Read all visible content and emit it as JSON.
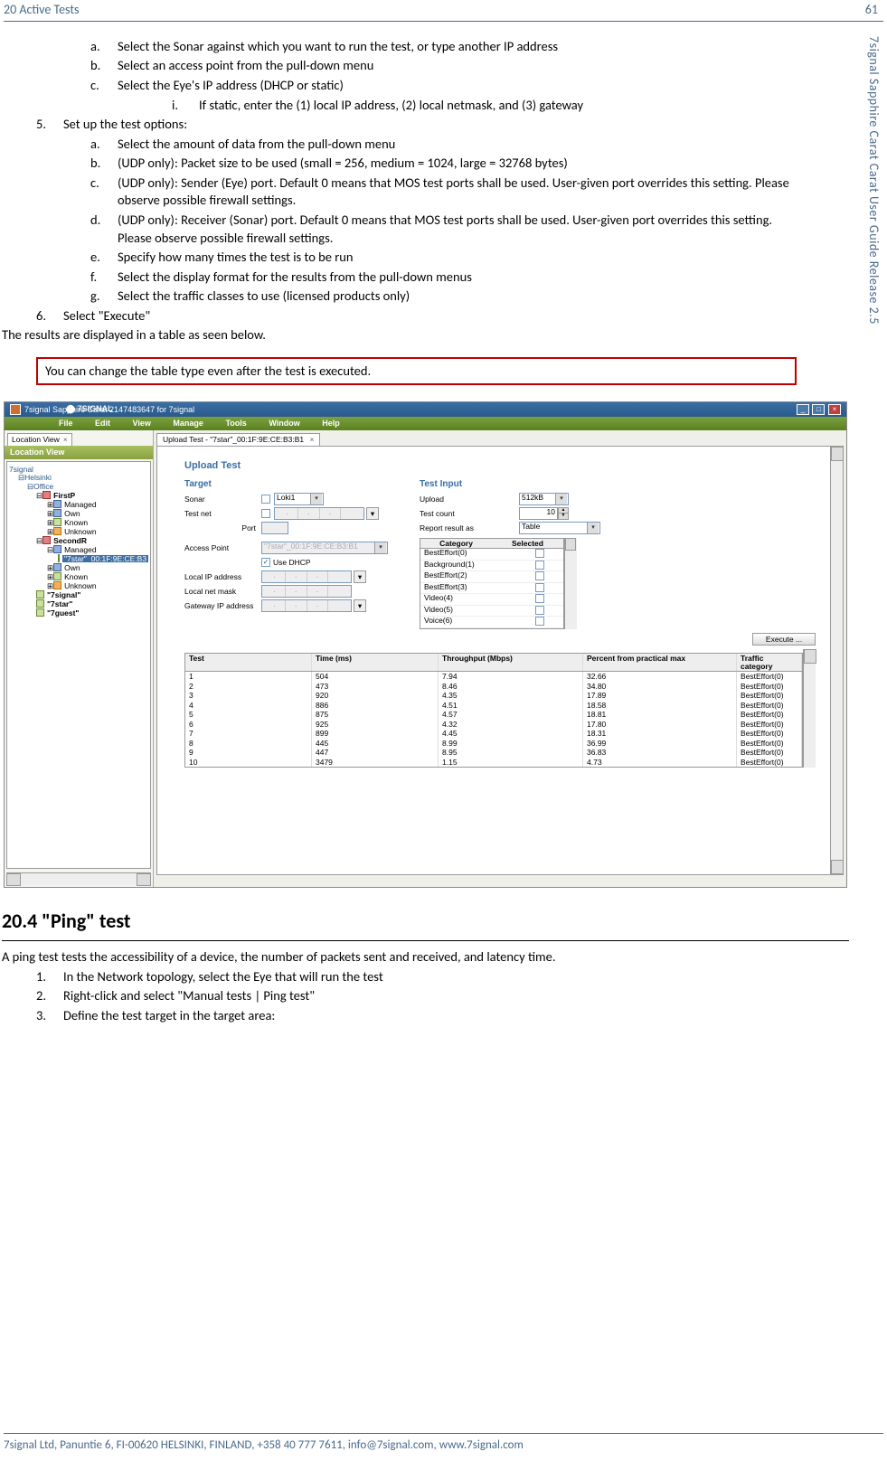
{
  "header": {
    "left": "20 Active Tests",
    "right": "61"
  },
  "vertical_label": "7signal Sapphire Carat Carat User Guide Release 2.5",
  "steps": {
    "a4": {
      "m": "a.",
      "t": "Select the Sonar against which you want to run the test, or type another IP address"
    },
    "b4": {
      "m": "b.",
      "t": "Select an access point from the pull-down menu"
    },
    "c4": {
      "m": "c.",
      "t": "Select the Eye's IP address (DHCP or static)"
    },
    "c4i": {
      "m": "i.",
      "t": "If static, enter the (1) local IP address, (2) local netmask, and (3) gateway"
    },
    "s5": {
      "m": "5.",
      "t": "Set up the test options:"
    },
    "a5": {
      "m": "a.",
      "t": "Select the amount of data from the pull-down menu"
    },
    "b5": {
      "m": "b.",
      "t": "(UDP only): Packet size to be used (small = 256, medium = 1024, large = 32768 bytes)"
    },
    "c5": {
      "m": "c.",
      "t": "(UDP only): Sender (Eye) port. Default 0 means that MOS test ports shall be used. User-given port overrides this setting. Please observe possible firewall settings."
    },
    "d5": {
      "m": "d.",
      "t": "(UDP only): Receiver (Sonar) port. Default 0 means that MOS test ports shall be used. User-given port overrides this setting. Please observe possible firewall settings."
    },
    "e5": {
      "m": "e.",
      "t": "Specify how many times the test is to be run"
    },
    "f5": {
      "m": "f.",
      "t": "Select the display format for the results from the pull-down menus"
    },
    "g5": {
      "m": "g.",
      "t": "Select the traffic classes to use (licensed products only)"
    },
    "s6": {
      "m": "6.",
      "t": "Select \"Execute\""
    }
  },
  "para_results": "The results are displayed in a table as seen below.",
  "note": "You can change the table type even after the test is executed.",
  "section_title": "20.4 \"Ping\" test",
  "ping_intro": "A ping test tests the accessibility of a device, the number of packets sent and received, and latency time.",
  "ping_steps": {
    "s1": {
      "m": "1.",
      "t": "In the Network topology, select the Eye that will run the test"
    },
    "s2": {
      "m": "2.",
      "t": "Right-click and select \"Manual tests | Ping test\""
    },
    "s3": {
      "m": "3.",
      "t": "Define the test target in the target area:"
    }
  },
  "footer": "7signal Ltd, Panuntie 6, FI-00620 HELSINKI, FINLAND, +358 40 777 7611, info@7signal.com, www.7signal.com",
  "ss": {
    "title": "7signal Sapphire Carat  2147483647 for 7signal",
    "menu": [
      "File",
      "Edit",
      "View",
      "Manage",
      "Tools",
      "Window",
      "Help"
    ],
    "logo": "7SIGNAL",
    "left_tab": "Location View",
    "left_head": "Location View",
    "tree": {
      "root": "7signal",
      "n1": "Helsinki",
      "n2": "Office",
      "r1": "FirstP",
      "items1": [
        "Managed",
        "Own",
        "Known",
        "Unknown"
      ],
      "r2": "SecondR",
      "mgd": "Managed",
      "sel": "\"7star\"_00:1F:9E:CE:B3",
      "items2": [
        "Own",
        "Known",
        "Unknown"
      ],
      "q": [
        "\"7signal\"",
        "\"7star\"",
        "\"7guest\""
      ]
    },
    "right_tab": "Upload Test - \"7star\"_00:1F:9E:CE:B3:B1",
    "form": {
      "h1": "Upload Test",
      "target": "Target",
      "sonar": "Sonar",
      "sonar_val": "Loki1",
      "testnet": "Test net",
      "port": "Port",
      "ap": "Access Point",
      "ap_val": "\"7star\"_00:1F:9E:CE:B3:B1",
      "dhcp": "Use DHCP",
      "lip": "Local IP address",
      "lnm": "Local net mask",
      "gip": "Gateway IP address",
      "input_h": "Test Input",
      "upload": "Upload",
      "upload_val": "512kB",
      "tcount": "Test count",
      "tcount_val": "10",
      "report": "Report result as",
      "report_val": "Table",
      "cat_h1": "Category",
      "cat_h2": "Selected",
      "cats": [
        "BestEffort(0)",
        "Background(1)",
        "BestEffort(2)",
        "BestEffort(3)",
        "Video(4)",
        "Video(5)",
        "Voice(6)"
      ],
      "exec": "Execute ..."
    },
    "results": {
      "h": [
        "Test",
        "Time (ms)",
        "Throughput (Mbps)",
        "Percent from practical max",
        "Traffic category"
      ],
      "rows": [
        [
          "1",
          "504",
          "7.94",
          "32.66",
          "BestEffort(0)"
        ],
        [
          "2",
          "473",
          "8.46",
          "34.80",
          "BestEffort(0)"
        ],
        [
          "3",
          "920",
          "4.35",
          "17.89",
          "BestEffort(0)"
        ],
        [
          "4",
          "886",
          "4.51",
          "18.58",
          "BestEffort(0)"
        ],
        [
          "5",
          "875",
          "4.57",
          "18.81",
          "BestEffort(0)"
        ],
        [
          "6",
          "925",
          "4.32",
          "17.80",
          "BestEffort(0)"
        ],
        [
          "7",
          "899",
          "4.45",
          "18.31",
          "BestEffort(0)"
        ],
        [
          "8",
          "445",
          "8.99",
          "36.99",
          "BestEffort(0)"
        ],
        [
          "9",
          "447",
          "8.95",
          "36.83",
          "BestEffort(0)"
        ],
        [
          "10",
          "3479",
          "1.15",
          "4.73",
          "BestEffort(0)"
        ]
      ]
    }
  }
}
